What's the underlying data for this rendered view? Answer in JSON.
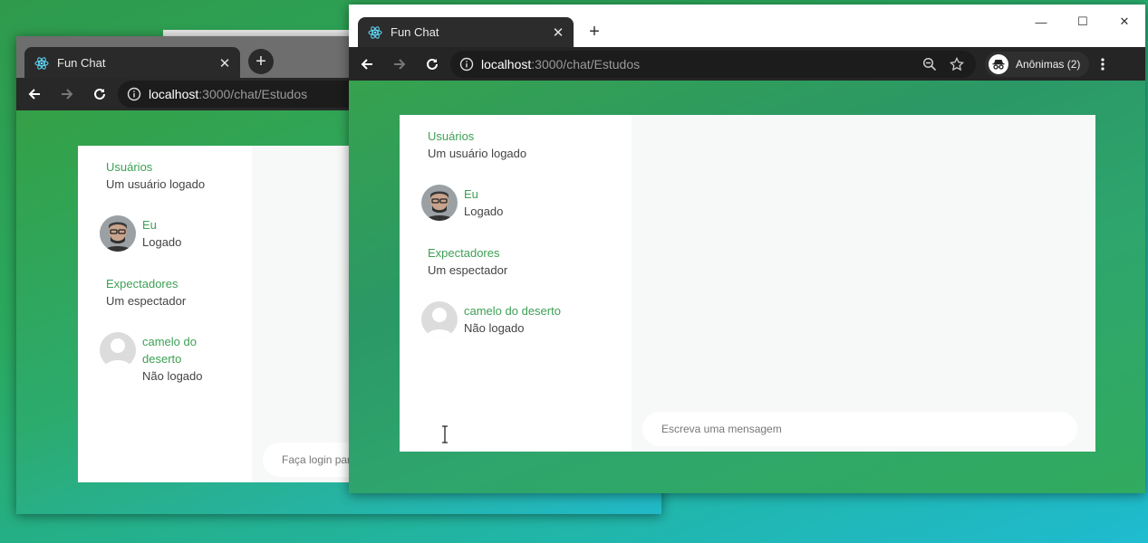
{
  "back_window": {
    "tab_title": "Fun Chat",
    "url_host": "localhost",
    "url_path": ":3000/chat/Estudos",
    "sidebar": {
      "users_title": "Usuários",
      "users_count": "Um usuário logado",
      "me_name": "Eu",
      "me_status": "Logado",
      "spectators_title": "Expectadores",
      "spectators_count": "Um espectador",
      "spectator_name_line1": "camelo do",
      "spectator_name_line2": "deserto",
      "spectator_status": "Não logado"
    },
    "message_placeholder": "Faça login para"
  },
  "front_window": {
    "tab_title": "Fun Chat",
    "url_host": "localhost",
    "url_path": ":3000/chat/Estudos",
    "incognito_label": "Anônimas (2)",
    "sidebar": {
      "users_title": "Usuários",
      "users_count": "Um usuário logado",
      "me_name": "Eu",
      "me_status": "Logado",
      "spectators_title": "Expectadores",
      "spectators_count": "Um espectador",
      "spectator_name": "camelo do deserto",
      "spectator_status": "Não logado"
    },
    "message_placeholder": "Escreva uma mensagem"
  },
  "icons": {
    "favicon": "react-atom-icon",
    "back": "arrow-left-icon",
    "forward": "arrow-right-icon",
    "reload": "reload-icon",
    "info": "info-icon",
    "zoom": "zoom-out-icon",
    "bookmark": "star-icon",
    "incognito": "incognito-icon",
    "menu": "kebab-icon"
  },
  "colors": {
    "accent_green": "#3ea055",
    "chrome_dark": "#282828"
  }
}
